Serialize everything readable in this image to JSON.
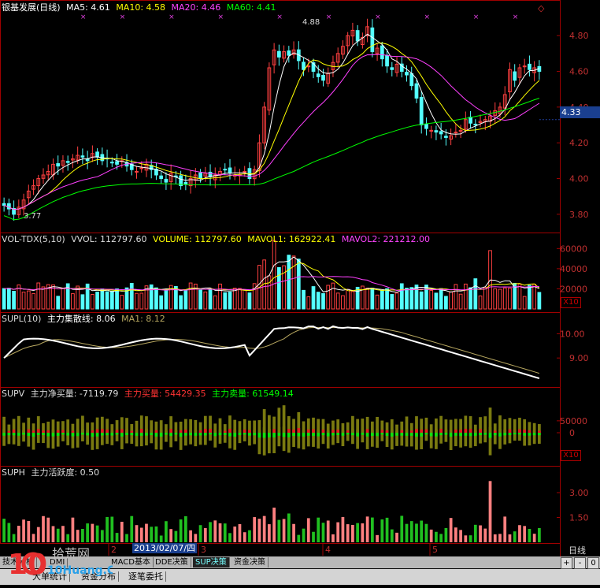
{
  "panel1": {
    "title": "银基发展(日线)",
    "ma5": "MA5: 4.61",
    "ma10": "MA10: 4.58",
    "ma20": "MA20: 4.46",
    "ma60": "MA60: 4.41",
    "price_badge": "4.33",
    "high_label": "4.88",
    "low_label": "3.77",
    "y_ticks": [
      "4.80",
      "4.60",
      "4.40",
      "4.20",
      "4.00",
      "3.80"
    ],
    "colors": {
      "ma5": "#ffffff",
      "ma10": "#ffff00",
      "ma20": "#ff40ff",
      "ma60": "#00ff00",
      "up": "#ff4040",
      "down": "#54ffff"
    }
  },
  "panel2": {
    "title": "VOL-TDX(5,10)",
    "vvol": "VVOL: 112797.60",
    "volume": "VOLUME: 112797.60",
    "mavol1": "MAVOL1: 162922.41",
    "mavol2": "MAVOL2: 221212.00",
    "y_ticks": [
      "60000",
      "40000",
      "20000"
    ],
    "x10": "X10"
  },
  "panel3": {
    "title": "SUPL(10)",
    "label": "主力集散线: 8.06",
    "ma1": "MA1: 8.12",
    "y_ticks": [
      "10.00",
      "9.00"
    ]
  },
  "panel4": {
    "title": "SUPV",
    "net": "主力净买量: -7119.79",
    "buy": "主力买量: 54429.35",
    "sell": "主力卖量: 61549.14",
    "y_ticks": [
      "50000",
      "0"
    ],
    "x10": "X10"
  },
  "panel5": {
    "title": "SUPH",
    "label": "主力活跃度: 0.50",
    "y_ticks": [
      "3.00",
      "1.50"
    ]
  },
  "axis": {
    "selected_date": "2013/02/07/四",
    "months": [
      "2",
      "3",
      "4",
      "5"
    ],
    "period": "日线"
  },
  "tabs": [
    "技术分析",
    "DMI",
    "MACD基本",
    "DDE决策",
    "SUP决策",
    "资金决策"
  ],
  "tabs2": [
    "大单统计",
    "资金分布",
    "逐笔委托"
  ],
  "controls": [
    "+",
    "-",
    "0"
  ],
  "watermark": {
    "line1": "拾荒网",
    "line2": "10Huang.CN",
    "digits": "10"
  },
  "chart_data": {
    "type": "candlestick",
    "bars": 110,
    "price_range": [
      3.72,
      4.92
    ],
    "close": [
      3.85,
      3.83,
      3.8,
      3.84,
      3.88,
      3.93,
      3.96,
      4.0,
      4.02,
      4.04,
      4.08,
      4.07,
      4.1,
      4.09,
      4.11,
      4.13,
      4.12,
      4.1,
      4.14,
      4.12,
      4.1,
      4.11,
      4.09,
      4.08,
      4.1,
      4.07,
      4.05,
      4.04,
      4.06,
      4.08,
      4.05,
      4.02,
      4.0,
      3.98,
      4.03,
      4.01,
      3.96,
      3.97,
      4.0,
      4.02,
      4.0,
      4.03,
      4.01,
      4.02,
      4.04,
      4.05,
      4.03,
      4.02,
      4.02,
      4.04,
      4.0,
      4.05,
      4.2,
      4.4,
      4.62,
      4.72,
      4.68,
      4.71,
      4.69,
      4.72,
      4.66,
      4.61,
      4.63,
      4.6,
      4.57,
      4.55,
      4.59,
      4.65,
      4.7,
      4.74,
      4.8,
      4.83,
      4.77,
      4.79,
      4.85,
      4.71,
      4.73,
      4.67,
      4.63,
      4.61,
      4.64,
      4.6,
      4.58,
      4.52,
      4.45,
      4.3,
      4.28,
      4.27,
      4.26,
      4.25,
      4.23,
      4.24,
      4.26,
      4.27,
      4.33,
      4.31,
      4.3,
      4.32,
      4.33,
      4.35,
      4.38,
      4.4,
      4.47,
      4.61,
      4.55,
      4.62,
      4.63,
      4.61,
      4.62,
      4.6
    ]
  }
}
